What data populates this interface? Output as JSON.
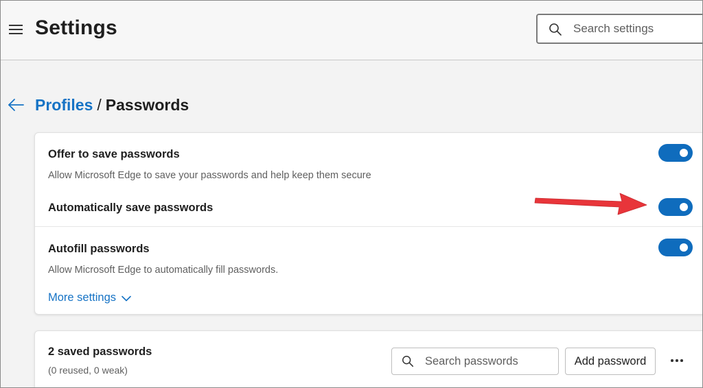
{
  "header": {
    "title": "Settings",
    "search_placeholder": "Search settings"
  },
  "breadcrumb": {
    "parent": "Profiles",
    "separator": "/",
    "current": "Passwords"
  },
  "password_settings": {
    "offer_to_save": {
      "title": "Offer to save passwords",
      "description": "Allow Microsoft Edge to save your passwords and help keep them secure",
      "enabled": true
    },
    "auto_save": {
      "title": "Automatically save passwords",
      "enabled": true
    },
    "autofill": {
      "title": "Autofill passwords",
      "description": "Allow Microsoft Edge to automatically fill passwords.",
      "enabled": true
    },
    "more_settings_label": "More settings"
  },
  "saved_passwords": {
    "count_label": "2 saved passwords",
    "summary": "(0 reused, 0 weak)",
    "search_placeholder": "Search passwords",
    "add_button_label": "Add password"
  },
  "colors": {
    "accent": "#0f6cbd",
    "link": "#1673c5",
    "annotation_arrow": "#e8353a"
  },
  "icons": {
    "menu": "hamburger-menu-icon",
    "search": "search-icon",
    "back": "back-arrow-icon",
    "chevron": "chevron-down-icon",
    "more": "more-options-icon"
  }
}
